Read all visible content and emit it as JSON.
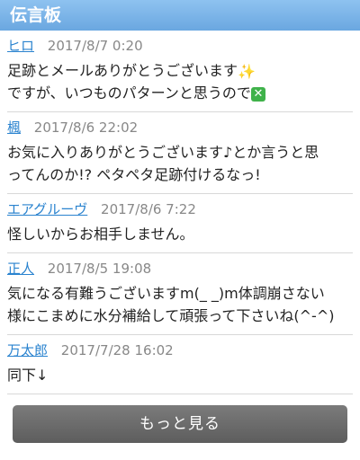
{
  "header": {
    "title": "伝言板"
  },
  "posts": [
    {
      "author": "ヒロ",
      "date": "2017/8/7 0:20",
      "line1": "足跡とメールありがとうございます",
      "line2": "ですが、いつものパターンと思うので"
    },
    {
      "author": "楓",
      "date": "2017/8/6 22:02",
      "line1": "お気に入りありがとうございます♪とか言うと思",
      "line2": "ってんのか!? ペタペタ足跡付けるなっ!"
    },
    {
      "author": "エアグルーヴ",
      "date": "2017/8/6 7:22",
      "line1": "怪しいからお相手しません。"
    },
    {
      "author": "正人",
      "date": "2017/8/5 19:08",
      "line1": "気になる有難うございますm(_ _)m体調崩さない",
      "line2": "様にこまめに水分補給して頑張って下さいね(^-^)"
    },
    {
      "author": "万太郎",
      "date": "2017/7/28 16:02",
      "line1": "同下↓"
    }
  ],
  "more_button": {
    "label": "もっと見る"
  },
  "icons": {
    "sparkle": "sparkles-icon",
    "cross": "cross-mark-icon"
  },
  "colors": {
    "header": "#7fb6e8",
    "author_link": "#2a83cf",
    "button": "#6b6b6b"
  }
}
